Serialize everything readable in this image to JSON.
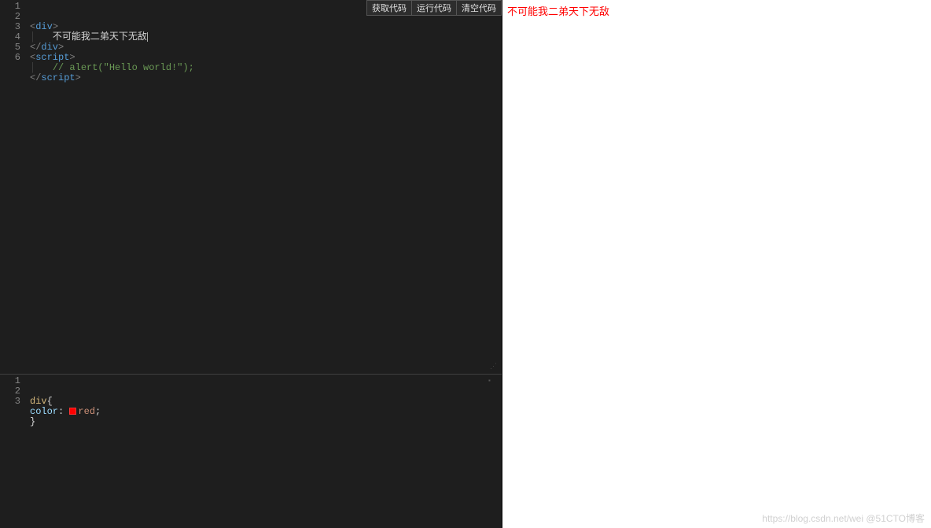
{
  "toolbar": {
    "get_code": "获取代码",
    "run_code": "运行代码",
    "clear_code": "清空代码"
  },
  "editor_top": {
    "lines": [
      {
        "n": "1",
        "html": "<span class='bracket'>&lt;</span><span class='tag'>div</span><span class='bracket'>&gt;</span>"
      },
      {
        "n": "2",
        "html": "<span class='indent-guide'>│   </span><span class='text'>不可能我二弟天下无敌</span><span class='cursor'></span>"
      },
      {
        "n": "3",
        "html": "<span class='bracket'>&lt;/</span><span class='tag'>div</span><span class='bracket'>&gt;</span>"
      },
      {
        "n": "4",
        "html": "<span class='bracket'>&lt;</span><span class='tag'>script</span><span class='bracket'>&gt;</span>"
      },
      {
        "n": "5",
        "html": "<span class='indent-guide'>│   </span><span class='comment'>// alert(\"Hello world!\");</span>"
      },
      {
        "n": "6",
        "html": "<span class='bracket'>&lt;/</span><span class='tag'>script</span><span class='bracket'>&gt;</span>"
      }
    ]
  },
  "editor_bottom": {
    "lines": [
      {
        "n": "1",
        "html": "<span class='sel'>div</span><span class='text'>{</span>"
      },
      {
        "n": "2",
        "html": "<span class='prop'>color</span><span class='text'>: </span><span class='swatch'></span><span class='val-red'>red</span><span class='text'>;</span>"
      },
      {
        "n": "3",
        "html": "<span class='text'>}</span>"
      }
    ]
  },
  "preview": {
    "content": "不可能我二弟天下无敌"
  },
  "watermark": "https://blog.csdn.net/wei @51CTO博客"
}
